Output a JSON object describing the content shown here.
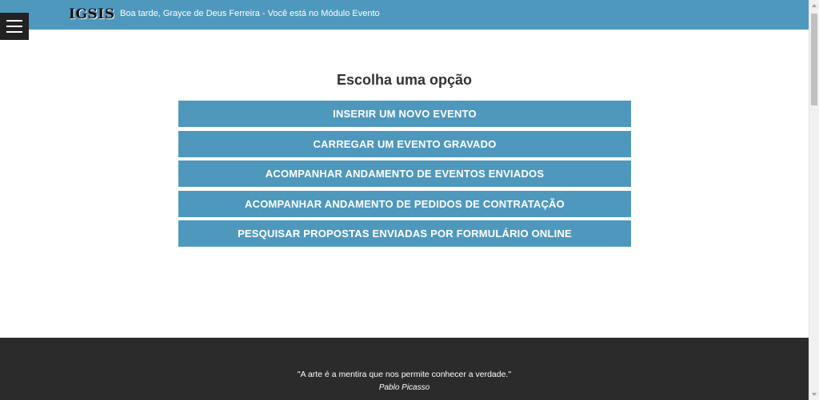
{
  "header": {
    "brand": "IGSIS",
    "greeting": "Boa tarde, Grayce de Deus Ferreira - Você está no Módulo Evento",
    "menu_icon": "hamburger-menu-icon"
  },
  "main": {
    "title": "Escolha uma opção",
    "options": [
      {
        "label": "INSERIR UM NOVO EVENTO"
      },
      {
        "label": "CARREGAR UM EVENTO GRAVADO"
      },
      {
        "label": "ACOMPANHAR ANDAMENTO DE EVENTOS ENVIADOS"
      },
      {
        "label": "ACOMPANHAR ANDAMENTO DE PEDIDOS DE CONTRATAÇÃO"
      },
      {
        "label": "PESQUISAR PROPOSTAS ENVIADAS POR FORMULÁRIO ONLINE"
      }
    ]
  },
  "footer": {
    "quote": "\"A arte é a mentira que nos permite conhecer a verdade.\"",
    "author": "Pablo Picasso"
  },
  "colors": {
    "accent": "#4f98bd",
    "footer_bg": "#2b2b2b",
    "menu_bg": "#222222"
  }
}
